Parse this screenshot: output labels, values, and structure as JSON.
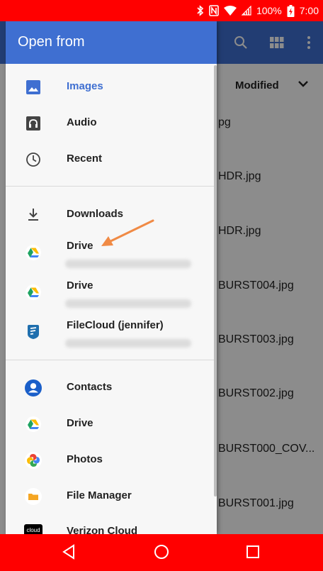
{
  "status_bar": {
    "battery": "100%",
    "time": "7:00",
    "color": "#ff0000"
  },
  "drawer": {
    "title": "Open from",
    "sections": [
      {
        "items": [
          {
            "label": "Images",
            "icon": "image-icon",
            "active": true
          },
          {
            "label": "Audio",
            "icon": "audio-icon"
          },
          {
            "label": "Recent",
            "icon": "clock-icon"
          }
        ]
      },
      {
        "items": [
          {
            "label": "Downloads",
            "icon": "download-icon"
          },
          {
            "label": "Drive",
            "icon": "google-drive-icon",
            "has_subtitle": true
          },
          {
            "label": "Drive",
            "icon": "google-drive-icon",
            "has_subtitle": true
          },
          {
            "label": "FileCloud (jennifer)",
            "icon": "filecloud-icon",
            "has_subtitle": true
          }
        ]
      },
      {
        "items": [
          {
            "label": "Contacts",
            "icon": "contacts-icon"
          },
          {
            "label": "Drive",
            "icon": "google-drive-icon"
          },
          {
            "label": "Photos",
            "icon": "google-photos-icon"
          },
          {
            "label": "File Manager",
            "icon": "folder-icon"
          },
          {
            "label": "Verizon Cloud",
            "icon": "verizon-cloud-icon",
            "icon_text": "cloud"
          }
        ]
      }
    ]
  },
  "background_app": {
    "sort_label": "Modified",
    "files": [
      "pg",
      "HDR.jpg",
      "HDR.jpg",
      "BURST004.jpg",
      "BURST003.jpg",
      "BURST002.jpg",
      "BURST000_COV...",
      "BURST001.jpg"
    ]
  },
  "colors": {
    "accent": "#3f6fd1",
    "annotation_arrow": "#f08a45",
    "system_bars": "#ff0000"
  }
}
